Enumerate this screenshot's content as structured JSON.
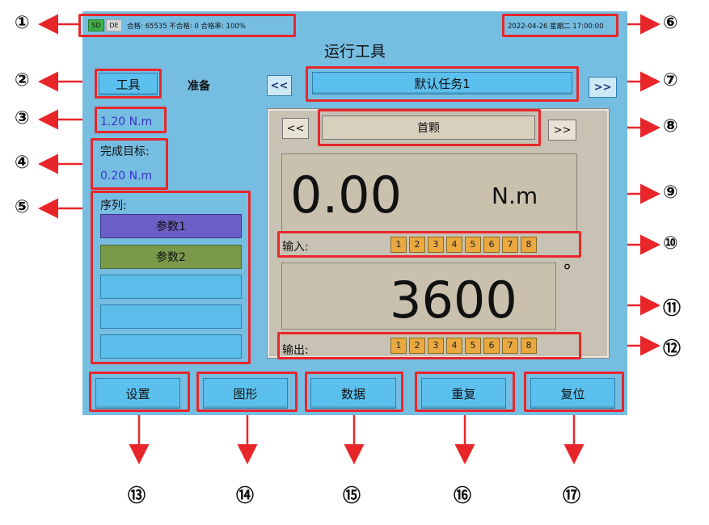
{
  "status_bar": {
    "sd_label": "SD",
    "de_label": "DE",
    "stats_text": "合格: 65535 不合格: 0 合格率: 100%",
    "datetime": "2022-04-26 星期二 17:00:00"
  },
  "screen_title": "运行工具",
  "tool_button": "工具",
  "status_text": "准备",
  "task": {
    "prev_label": "<<",
    "name": "默认任务1",
    "next_label": ">>"
  },
  "torque_target": "1.20 N.m",
  "completion": {
    "label": "完成目标:",
    "value": "0.20 N.m"
  },
  "sequence": {
    "label": "序列:",
    "items": [
      "参数1",
      "参数2",
      "",
      "",
      ""
    ]
  },
  "screw": {
    "prev_label": "<<",
    "name": "首颗",
    "next_label": ">>"
  },
  "torque_reading": {
    "value": "0.00",
    "unit": "N.m"
  },
  "inputs": {
    "label": "输入:",
    "channels": [
      "1",
      "2",
      "3",
      "4",
      "5",
      "6",
      "7",
      "8"
    ]
  },
  "angle_reading": {
    "value": "3600",
    "unit": "°"
  },
  "outputs": {
    "label": "输出:",
    "channels": [
      "1",
      "2",
      "3",
      "4",
      "5",
      "6",
      "7",
      "8"
    ]
  },
  "bottom_buttons": [
    "设置",
    "图形",
    "数据",
    "重复",
    "复位"
  ],
  "callouts": [
    "①",
    "②",
    "③",
    "④",
    "⑤",
    "⑥",
    "⑦",
    "⑧",
    "⑨",
    "⑩",
    "⑪",
    "⑫",
    "⑬",
    "⑭",
    "⑮",
    "⑯",
    "⑰"
  ],
  "colors": {
    "screen_bg": "#76bde2",
    "annotation_red": "#e8262a",
    "button_blue": "#5cc0ee",
    "io_orange": "#e9a93e",
    "param1_purple": "#6d5fc8",
    "param2_green": "#7a9a4a",
    "readout_beige": "#c9c1ae"
  }
}
